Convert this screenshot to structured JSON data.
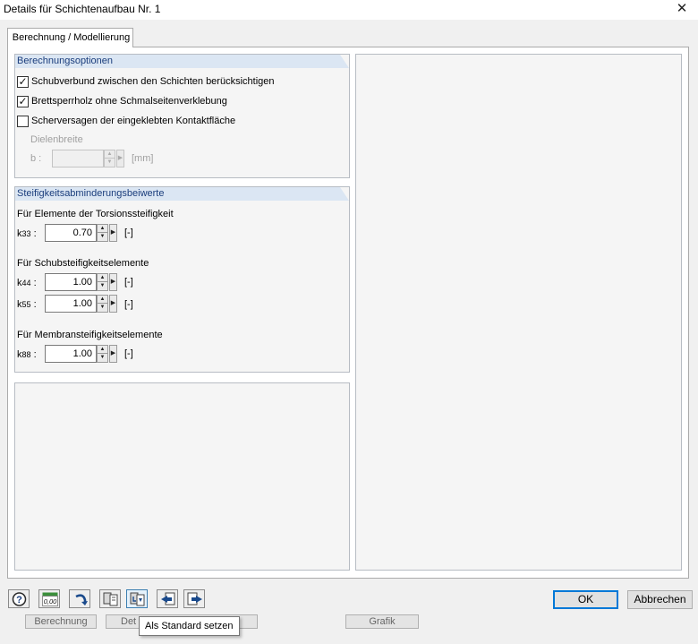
{
  "window": {
    "title": "Details für Schichtenaufbau Nr. 1",
    "close_glyph": "✕"
  },
  "tabs": [
    {
      "label": "Berechnung / Modellierung",
      "active": true
    }
  ],
  "calc_options": {
    "header": "Berechnungsoptionen",
    "checkboxes": [
      {
        "label": "Schubverbund zwischen den Schichten berücksichtigen",
        "checked": true
      },
      {
        "label": "Brettsperrholz ohne Schmalseitenverklebung",
        "checked": true
      },
      {
        "label": "Scherversagen der eingeklebten Kontaktfläche",
        "checked": false
      }
    ],
    "plank_width": {
      "label": "Dielenbreite",
      "symbol": "b :",
      "value": "",
      "unit": "[mm]",
      "enabled": false
    }
  },
  "stiffness": {
    "header": "Steifigkeitsabminderungsbeiwerte",
    "groups": [
      {
        "heading": "Für Elemente der Torsionssteifigkeit",
        "rows": [
          {
            "symbol": "k",
            "sub": "33",
            "value": "0.70",
            "unit": "[-]"
          }
        ]
      },
      {
        "heading": "Für Schubsteifigkeitselemente",
        "rows": [
          {
            "symbol": "k",
            "sub": "44",
            "value": "1.00",
            "unit": "[-]"
          },
          {
            "symbol": "k",
            "sub": "55",
            "value": "1.00",
            "unit": "[-]"
          }
        ]
      },
      {
        "heading": "Für Membransteifigkeitselemente",
        "rows": [
          {
            "symbol": "k",
            "sub": "88",
            "value": "1.00",
            "unit": "[-]"
          }
        ]
      }
    ]
  },
  "toolbar": {
    "icons": [
      "help-icon",
      "units-icon",
      "undo-icon",
      "copy-icon",
      "set-default-icon",
      "import-icon",
      "export-icon"
    ],
    "units_text": "0,00",
    "tooltip": "Als Standard setzen"
  },
  "buttons": {
    "ok": "OK",
    "cancel": "Abbrechen"
  },
  "background_tabs": [
    "Berechnung",
    "Det",
    "Grafik"
  ],
  "colors": {
    "header_bg": "#dbe6f3",
    "header_text": "#1a3d7c",
    "accent": "#0078d7"
  }
}
